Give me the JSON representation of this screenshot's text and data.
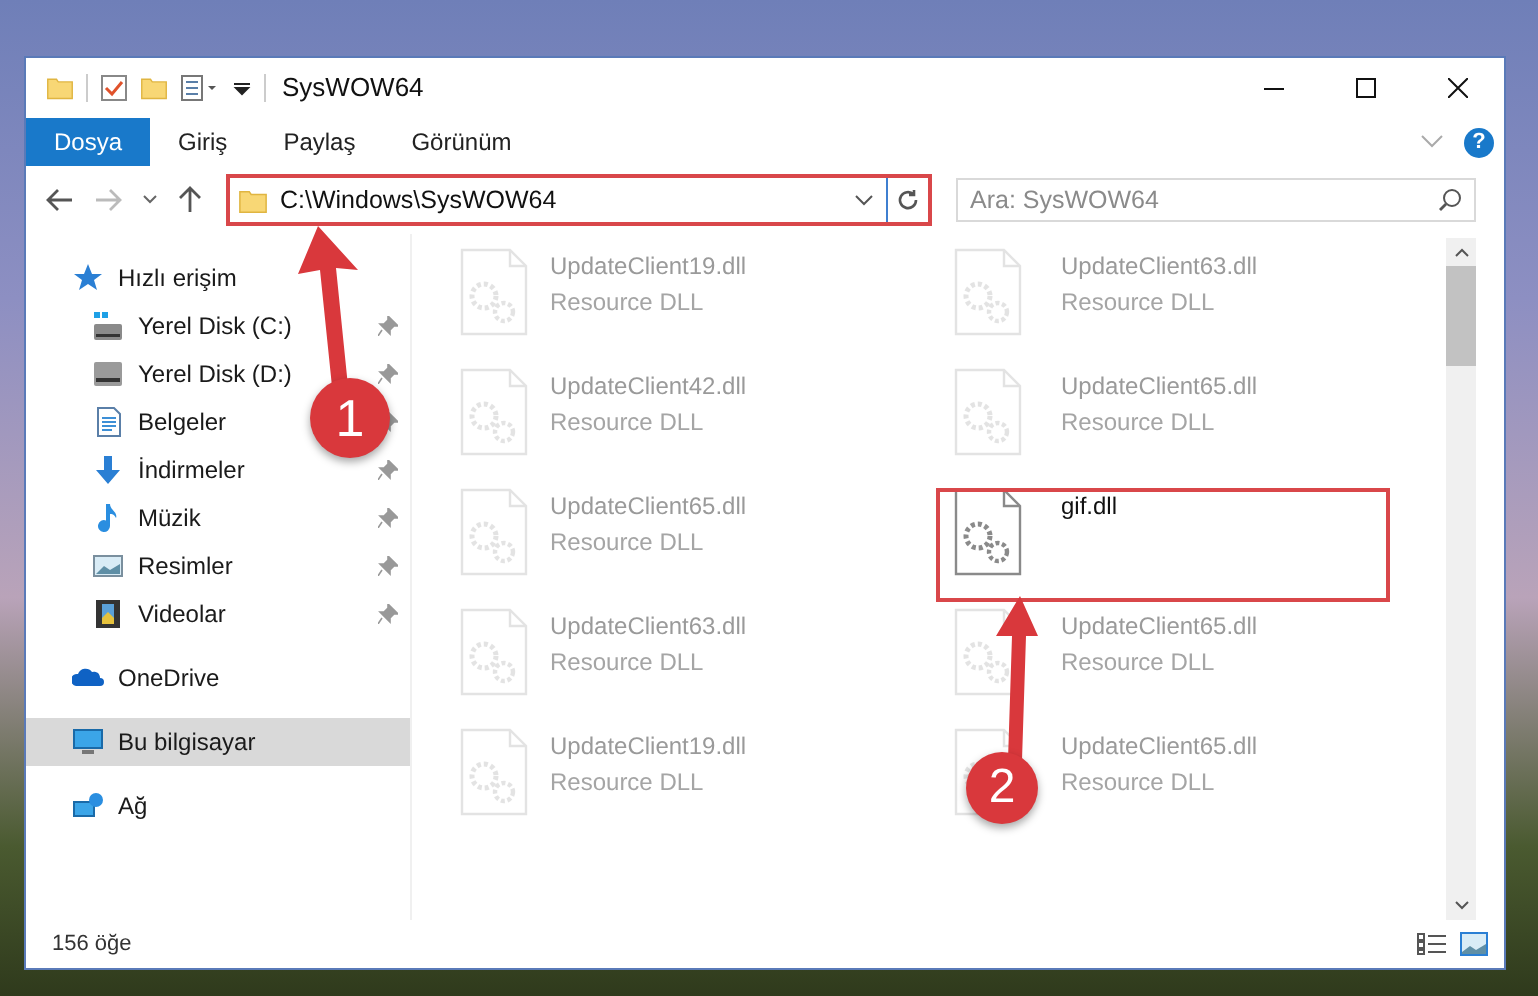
{
  "window": {
    "title": "SysWOW64"
  },
  "ribbon_tabs": [
    {
      "label": "Dosya",
      "selected": true
    },
    {
      "label": "Giriş",
      "selected": false
    },
    {
      "label": "Paylaş",
      "selected": false
    },
    {
      "label": "Görünüm",
      "selected": false
    }
  ],
  "address": {
    "path": "C:\\Windows\\SysWOW64"
  },
  "search": {
    "placeholder": "Ara: SysWOW64"
  },
  "help": {
    "label": "?"
  },
  "sidebar": {
    "items": [
      {
        "label": "Hızlı erişim",
        "kind": "star",
        "selected": false,
        "children": [
          {
            "label": "Yerel Disk (C:)",
            "kind": "drive-c",
            "pinned": true,
            "selected": false
          },
          {
            "label": "Yerel Disk (D:)",
            "kind": "drive",
            "pinned": true,
            "selected": false
          },
          {
            "label": "Belgeler",
            "kind": "docs",
            "pinned": true,
            "selected": false
          },
          {
            "label": "İndirmeler",
            "kind": "download",
            "pinned": true,
            "selected": false
          },
          {
            "label": "Müzik",
            "kind": "music",
            "pinned": true,
            "selected": false
          },
          {
            "label": "Resimler",
            "kind": "pictures",
            "pinned": true,
            "selected": false
          },
          {
            "label": "Videolar",
            "kind": "videos",
            "pinned": true,
            "selected": false
          }
        ]
      },
      {
        "label": "OneDrive",
        "kind": "cloud",
        "selected": false
      },
      {
        "label": "Bu bilgisayar",
        "kind": "computer",
        "selected": true
      },
      {
        "label": "Ağ",
        "kind": "network",
        "selected": false
      }
    ]
  },
  "files": [
    {
      "name": "UpdateClient19.dll",
      "type": "Resource DLL",
      "faded": true
    },
    {
      "name": "UpdateClient63.dll",
      "type": "Resource DLL",
      "faded": true
    },
    {
      "name": "UpdateClient42.dll",
      "type": "Resource DLL",
      "faded": true
    },
    {
      "name": "UpdateClient65.dll",
      "type": "Resource DLL",
      "faded": true
    },
    {
      "name": "UpdateClient65.dll",
      "type": "Resource DLL",
      "faded": true
    },
    {
      "name": "gif.dll",
      "faded": false
    },
    {
      "name": "UpdateClient63.dll",
      "type": "Resource DLL",
      "faded": true
    },
    {
      "name": "UpdateClient65.dll",
      "type": "Resource DLL",
      "faded": true
    },
    {
      "name": "UpdateClient19.dll",
      "type": "Resource DLL",
      "faded": true
    },
    {
      "name": "UpdateClient65.dll",
      "type": "Resource DLL",
      "faded": true
    }
  ],
  "status_bar": {
    "count": "156 öğe"
  },
  "annotations": [
    {
      "label": "1"
    },
    {
      "label": "2"
    }
  ]
}
